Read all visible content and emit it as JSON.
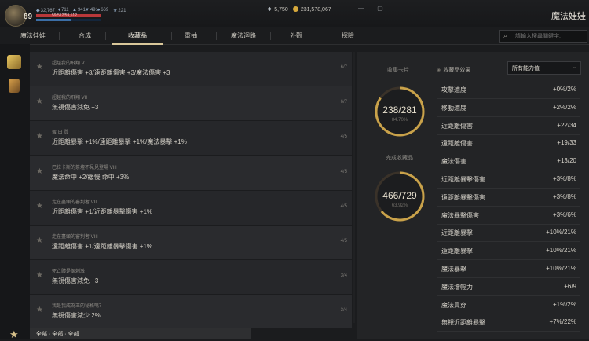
{
  "header": {
    "level": "89",
    "stats": [
      "32,767",
      "711",
      "941",
      "491",
      "669",
      "221"
    ],
    "hp_text": "59,512/59,512",
    "hp_fraction": 1.0,
    "mp_fraction": 0.55,
    "currency": {
      "gems": "5,750",
      "gold": "231,578,067"
    },
    "app_title": "魔法娃娃"
  },
  "nav": {
    "tabs": [
      "魔法娃娃",
      "合成",
      "收藏品",
      "重抽",
      "魔法迴路",
      "外觀",
      "探險"
    ],
    "active_index": 2,
    "search_placeholder": "請輸入搜尋關鍵字."
  },
  "collection_list": [
    {
      "title": "超越我的飛翔 V",
      "desc": "近距離傷害 +3/遠距離傷害 +3/魔法傷害 +3",
      "count": "6/7"
    },
    {
      "title": "超越我的飛翔 VII",
      "desc": "無視傷害減免 +3",
      "count": "6/7"
    },
    {
      "title": "蛋 白 質",
      "desc": "近距離暴擊 +1%/遠距離暴擊 +1%/魔法暴擊 +1%",
      "count": "4/5"
    },
    {
      "title": "巴拉卡斯的祭壇不見見登場 VIII",
      "desc": "魔法命中 +2/緩慢 命中 +3%",
      "count": "4/5"
    },
    {
      "title": "走在盡頭的審判者 VII",
      "desc": "近距離傷害 +1/近距離暴擊傷害 +1%",
      "count": "4/5"
    },
    {
      "title": "走在盡頭的審判者 VIII",
      "desc": "遠距離傷害 +1/遠距離暴擊傷害 +1%",
      "count": "4/5"
    },
    {
      "title": "死亡體是個刺激",
      "desc": "無視傷害減免 +3",
      "count": "3/4"
    },
    {
      "title": "我是我成為王的秘格嗎？",
      "desc": "無視傷害減少 2%",
      "count": "3/4"
    }
  ],
  "filter_text": "全部 · 全部 · 全部",
  "summary": {
    "cards_label": "收集卡片",
    "cards_value": "238/281",
    "cards_percent": "84.70%",
    "cards_fraction": 0.847,
    "complete_label": "完成收藏品",
    "complete_value": "466/729",
    "complete_percent": "63.92%",
    "complete_fraction": 0.6392
  },
  "effects": {
    "header": "收藏品效果",
    "dropdown_value": "所有能力值",
    "rows": [
      {
        "name": "攻擊速度",
        "value": "+0%/2%"
      },
      {
        "name": "移動速度",
        "value": "+2%/2%"
      },
      {
        "name": "近距離傷害",
        "value": "+22/34"
      },
      {
        "name": "遠距離傷害",
        "value": "+19/33"
      },
      {
        "name": "魔法傷害",
        "value": "+13/20"
      },
      {
        "name": "近距離暴擊傷害",
        "value": "+3%/8%"
      },
      {
        "name": "遠距離暴擊傷害",
        "value": "+3%/8%"
      },
      {
        "name": "魔法暴擊傷害",
        "value": "+3%/6%"
      },
      {
        "name": "近距離暴擊",
        "value": "+10%/21%"
      },
      {
        "name": "遠距離暴擊",
        "value": "+10%/21%"
      },
      {
        "name": "魔法暴擊",
        "value": "+10%/21%"
      },
      {
        "name": "魔法增幅力",
        "value": "+6/9"
      },
      {
        "name": "魔法貫穿",
        "value": "+1%/2%"
      },
      {
        "name": "無視近距離暴擊",
        "value": "+7%/22%"
      }
    ]
  },
  "colors": {
    "accent": "#d9c79a",
    "gold_ring": "#c9a24a",
    "hp": "#b9383a",
    "mp": "#3b6ea6"
  }
}
